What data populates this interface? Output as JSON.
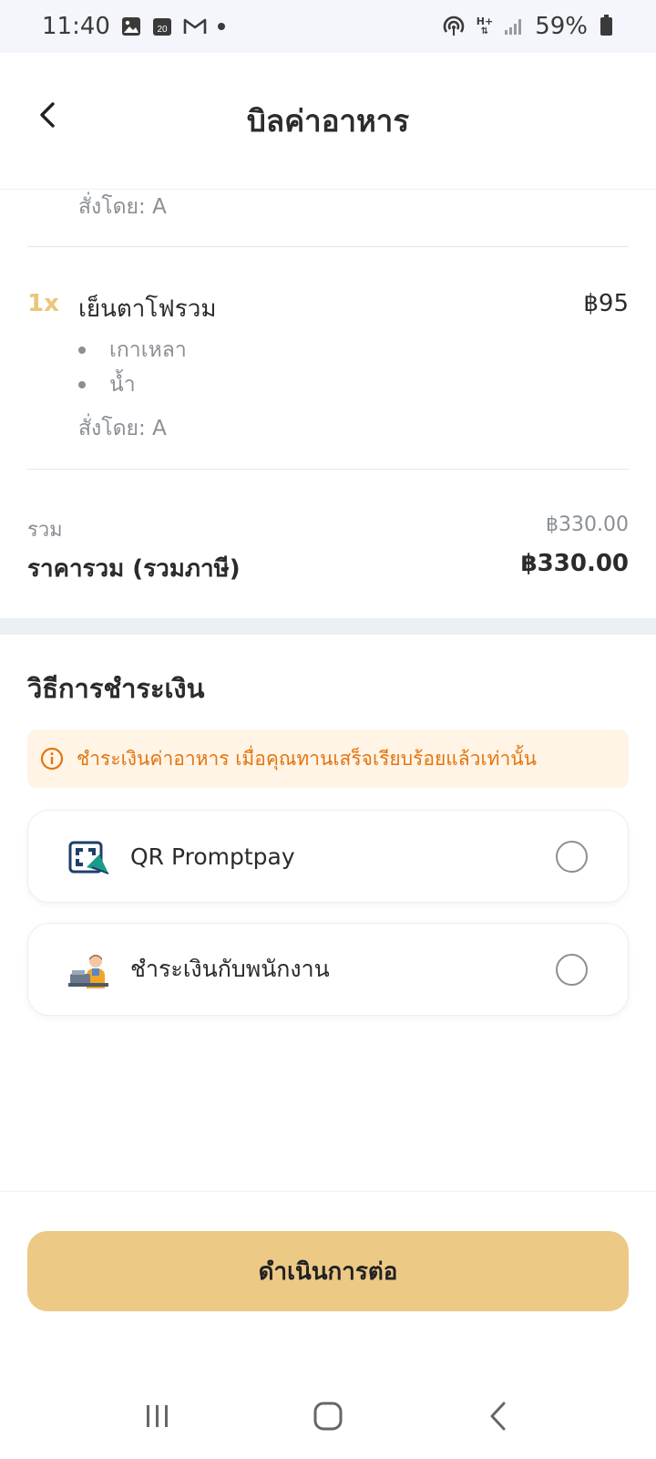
{
  "status_bar": {
    "time": "11:40",
    "calendar_day": "20",
    "battery": "59%",
    "network": "H+"
  },
  "header": {
    "title": "บิลค่าอาหาร"
  },
  "order": {
    "prev_item_ordered_by": "สั่งโดย: A",
    "item": {
      "qty": "1x",
      "name": "เย็นตาโฟรวม",
      "price": "฿95",
      "options": [
        "เกาเหลา",
        "น้ำ"
      ],
      "ordered_by": "สั่งโดย: A"
    }
  },
  "summary": {
    "subtotal_label": "รวม",
    "subtotal_value": "฿330.00",
    "total_label": "ราคารวม (รวมภาษี)",
    "total_value": "฿330.00"
  },
  "payment": {
    "title": "วิธีการชำระเงิน",
    "notice": "ชำระเงินค่าอาหาร เมื่อคุณทานเสร็จเรียบร้อยแล้วเท่านั้น",
    "options": [
      {
        "label": "QR Promptpay",
        "icon": "qr-promptpay-icon",
        "selected": false
      },
      {
        "label": "ชำระเงินกับพนักงาน",
        "icon": "cashier-staff-icon",
        "selected": false
      }
    ]
  },
  "actions": {
    "continue_label": "ดำเนินการต่อ"
  },
  "colors": {
    "accent": "#ECC985",
    "qty": "#E9C67B",
    "notice_bg": "#FFF4E6",
    "notice_text": "#E4740F"
  }
}
